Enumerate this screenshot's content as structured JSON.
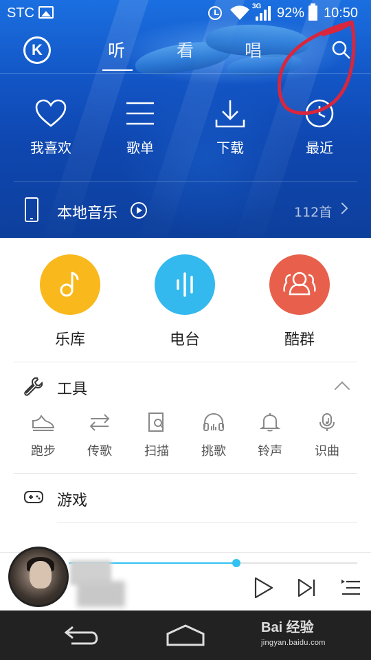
{
  "status_bar": {
    "carrier": "STC",
    "network": "3G",
    "battery": "92%",
    "time": "10:50"
  },
  "header": {
    "logo_letter": "K",
    "tabs": [
      {
        "label": "听",
        "active": true
      },
      {
        "label": "看",
        "active": false
      },
      {
        "label": "唱",
        "active": false
      }
    ],
    "search_icon": "search-icon"
  },
  "quick_actions": [
    {
      "label": "我喜欢",
      "icon": "heart-icon"
    },
    {
      "label": "歌单",
      "icon": "list-icon"
    },
    {
      "label": "下载",
      "icon": "download-icon"
    },
    {
      "label": "最近",
      "icon": "clock-icon"
    }
  ],
  "local_music": {
    "title": "本地音乐",
    "count": "112首"
  },
  "features": [
    {
      "label": "乐库",
      "color": "#f9b81c",
      "icon": "music-note-icon"
    },
    {
      "label": "电台",
      "color": "#33b9ee",
      "icon": "audio-wave-icon"
    },
    {
      "label": "酷群",
      "color": "#e8604c",
      "icon": "group-icon"
    }
  ],
  "tools": {
    "title": "工具",
    "items": [
      {
        "label": "跑步",
        "icon": "running-shoe-icon"
      },
      {
        "label": "传歌",
        "icon": "transfer-icon"
      },
      {
        "label": "扫描",
        "icon": "scan-icon"
      },
      {
        "label": "挑歌",
        "icon": "headphones-icon"
      },
      {
        "label": "铃声",
        "icon": "bell-icon"
      },
      {
        "label": "识曲",
        "icon": "music-recognition-icon"
      }
    ]
  },
  "games": {
    "title": "游戏"
  },
  "player": {
    "progress": 0.58,
    "accent": "#31c2f2"
  },
  "watermark": {
    "main": "Bai 经验",
    "sub": "jingyan.baidu.com"
  },
  "colors": {
    "annotation": "#d8263d"
  }
}
